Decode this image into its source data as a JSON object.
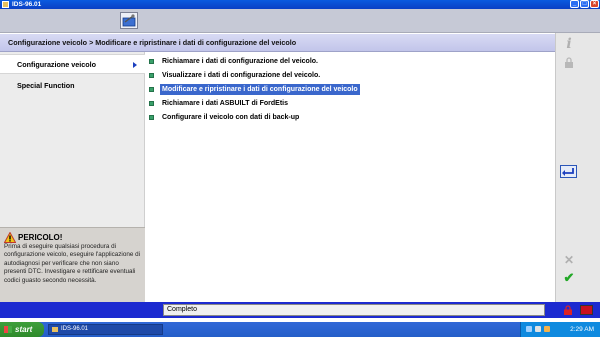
{
  "window": {
    "title": "IDS-96.01",
    "minimize": "_",
    "maximize": "□",
    "close": "×"
  },
  "header": {
    "breadcrumb": "Configurazione veicolo > Modificare e ripristinare i dati di configurazione del veicolo"
  },
  "sidebar": {
    "items": [
      {
        "label": "Configurazione veicolo",
        "active": true
      },
      {
        "label": "Special Function",
        "active": false
      }
    ]
  },
  "options": [
    {
      "label": "Richiamare i dati di configurazione del veicolo.",
      "selected": false
    },
    {
      "label": "Visualizzare i dati di configurazione del veicolo.",
      "selected": false
    },
    {
      "label": "Modificare e ripristinare i dati di configurazione del veicolo",
      "selected": true
    },
    {
      "label": "Richiamare i dati ASBUILT di FordEtis",
      "selected": false
    },
    {
      "label": "Configurare il veicolo con dati di back-up",
      "selected": false
    }
  ],
  "warning": {
    "title": "PERICOLO!",
    "text": "Prima di eseguire qualsiasi procedura di configurazione veicolo, eseguire l'applicazione di autodiagnosi per verificare che non siano presenti DTC. Investigare e rettificare eventuali codici guasto secondo necessità."
  },
  "statusbar": {
    "text": "Completo"
  },
  "taskbar": {
    "start": "start",
    "task": "IDS-96.01",
    "clock": "2:29 AM"
  },
  "colors": {
    "accent": "#3a67cc",
    "header": "#c2c5ea",
    "status": "#1c2ad0"
  },
  "icons": [
    "info-icon",
    "lock-icon",
    "back-arrow-icon",
    "cancel-x-icon",
    "confirm-check-icon",
    "warning-icon",
    "exit-icon"
  ]
}
